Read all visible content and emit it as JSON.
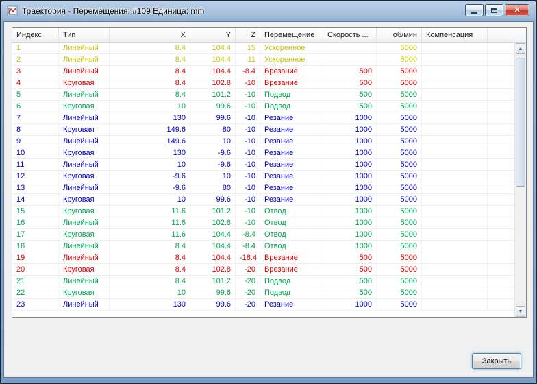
{
  "window": {
    "title": "Траектория - Перемещения: #109 Единица: mm"
  },
  "footer": {
    "close_label": "Закрыть"
  },
  "colors": {
    "yellow": "#c6c400",
    "red": "#dd0000",
    "green": "#00a651",
    "blue": "#0000cc"
  },
  "table": {
    "columns": [
      {
        "key": "index",
        "label": "Индекс"
      },
      {
        "key": "type",
        "label": "Тип"
      },
      {
        "key": "x",
        "label": "X"
      },
      {
        "key": "y",
        "label": "Y"
      },
      {
        "key": "z",
        "label": "Z"
      },
      {
        "key": "move",
        "label": "Перемещение"
      },
      {
        "key": "speed",
        "label": "Скорость ..."
      },
      {
        "key": "rpm",
        "label": "об/мин"
      },
      {
        "key": "comp",
        "label": "Компенсация"
      }
    ],
    "rows": [
      {
        "index": 1,
        "type": "Линейный",
        "x": "8.4",
        "y": "104.4",
        "z": "15",
        "move": "Ускоренное",
        "speed": "",
        "rpm": "5000",
        "comp": "",
        "color": "yellow"
      },
      {
        "index": 2,
        "type": "Линейный",
        "x": "8.4",
        "y": "104.4",
        "z": "11",
        "move": "Ускоренное",
        "speed": "",
        "rpm": "5000",
        "comp": "",
        "color": "yellow"
      },
      {
        "index": 3,
        "type": "Линейный",
        "x": "8.4",
        "y": "104.4",
        "z": "-8.4",
        "move": "Врезание",
        "speed": "500",
        "rpm": "5000",
        "comp": "",
        "color": "red"
      },
      {
        "index": 4,
        "type": "Круговая",
        "x": "8.4",
        "y": "102.8",
        "z": "-10",
        "move": "Врезание",
        "speed": "500",
        "rpm": "5000",
        "comp": "",
        "color": "red"
      },
      {
        "index": 5,
        "type": "Линейный",
        "x": "8.4",
        "y": "101.2",
        "z": "-10",
        "move": "Подвод",
        "speed": "500",
        "rpm": "5000",
        "comp": "",
        "color": "green"
      },
      {
        "index": 6,
        "type": "Круговая",
        "x": "10",
        "y": "99.6",
        "z": "-10",
        "move": "Подвод",
        "speed": "500",
        "rpm": "5000",
        "comp": "",
        "color": "green"
      },
      {
        "index": 7,
        "type": "Линейный",
        "x": "130",
        "y": "99.6",
        "z": "-10",
        "move": "Резание",
        "speed": "1000",
        "rpm": "5000",
        "comp": "",
        "color": "blue"
      },
      {
        "index": 8,
        "type": "Круговая",
        "x": "149.6",
        "y": "80",
        "z": "-10",
        "move": "Резание",
        "speed": "1000",
        "rpm": "5000",
        "comp": "",
        "color": "blue"
      },
      {
        "index": 9,
        "type": "Линейный",
        "x": "149.6",
        "y": "10",
        "z": "-10",
        "move": "Резание",
        "speed": "1000",
        "rpm": "5000",
        "comp": "",
        "color": "blue"
      },
      {
        "index": 10,
        "type": "Круговая",
        "x": "130",
        "y": "-9.6",
        "z": "-10",
        "move": "Резание",
        "speed": "1000",
        "rpm": "5000",
        "comp": "",
        "color": "blue"
      },
      {
        "index": 11,
        "type": "Линейный",
        "x": "10",
        "y": "-9.6",
        "z": "-10",
        "move": "Резание",
        "speed": "1000",
        "rpm": "5000",
        "comp": "",
        "color": "blue"
      },
      {
        "index": 12,
        "type": "Круговая",
        "x": "-9.6",
        "y": "10",
        "z": "-10",
        "move": "Резание",
        "speed": "1000",
        "rpm": "5000",
        "comp": "",
        "color": "blue"
      },
      {
        "index": 13,
        "type": "Линейный",
        "x": "-9.6",
        "y": "80",
        "z": "-10",
        "move": "Резание",
        "speed": "1000",
        "rpm": "5000",
        "comp": "",
        "color": "blue"
      },
      {
        "index": 14,
        "type": "Круговая",
        "x": "10",
        "y": "99.6",
        "z": "-10",
        "move": "Резание",
        "speed": "1000",
        "rpm": "5000",
        "comp": "",
        "color": "blue"
      },
      {
        "index": 15,
        "type": "Круговая",
        "x": "11.6",
        "y": "101.2",
        "z": "-10",
        "move": "Отвод",
        "speed": "1000",
        "rpm": "5000",
        "comp": "",
        "color": "green"
      },
      {
        "index": 16,
        "type": "Линейный",
        "x": "11.6",
        "y": "102.8",
        "z": "-10",
        "move": "Отвод",
        "speed": "1000",
        "rpm": "5000",
        "comp": "",
        "color": "green"
      },
      {
        "index": 17,
        "type": "Круговая",
        "x": "11.6",
        "y": "104.4",
        "z": "-8.4",
        "move": "Отвод",
        "speed": "1000",
        "rpm": "5000",
        "comp": "",
        "color": "green"
      },
      {
        "index": 18,
        "type": "Линейный",
        "x": "8.4",
        "y": "104.4",
        "z": "-8.4",
        "move": "Отвод",
        "speed": "1000",
        "rpm": "5000",
        "comp": "",
        "color": "green"
      },
      {
        "index": 19,
        "type": "Линейный",
        "x": "8.4",
        "y": "104.4",
        "z": "-18.4",
        "move": "Врезание",
        "speed": "500",
        "rpm": "5000",
        "comp": "",
        "color": "red"
      },
      {
        "index": 20,
        "type": "Круговая",
        "x": "8.4",
        "y": "102.8",
        "z": "-20",
        "move": "Врезание",
        "speed": "500",
        "rpm": "5000",
        "comp": "",
        "color": "red"
      },
      {
        "index": 21,
        "type": "Линейный",
        "x": "8.4",
        "y": "101.2",
        "z": "-20",
        "move": "Подвод",
        "speed": "500",
        "rpm": "5000",
        "comp": "",
        "color": "green"
      },
      {
        "index": 22,
        "type": "Круговая",
        "x": "10",
        "y": "99.6",
        "z": "-20",
        "move": "Подвод",
        "speed": "500",
        "rpm": "5000",
        "comp": "",
        "color": "green"
      },
      {
        "index": 23,
        "type": "Линейный",
        "x": "130",
        "y": "99.6",
        "z": "-20",
        "move": "Резание",
        "speed": "1000",
        "rpm": "5000",
        "comp": "",
        "color": "blue"
      }
    ]
  }
}
